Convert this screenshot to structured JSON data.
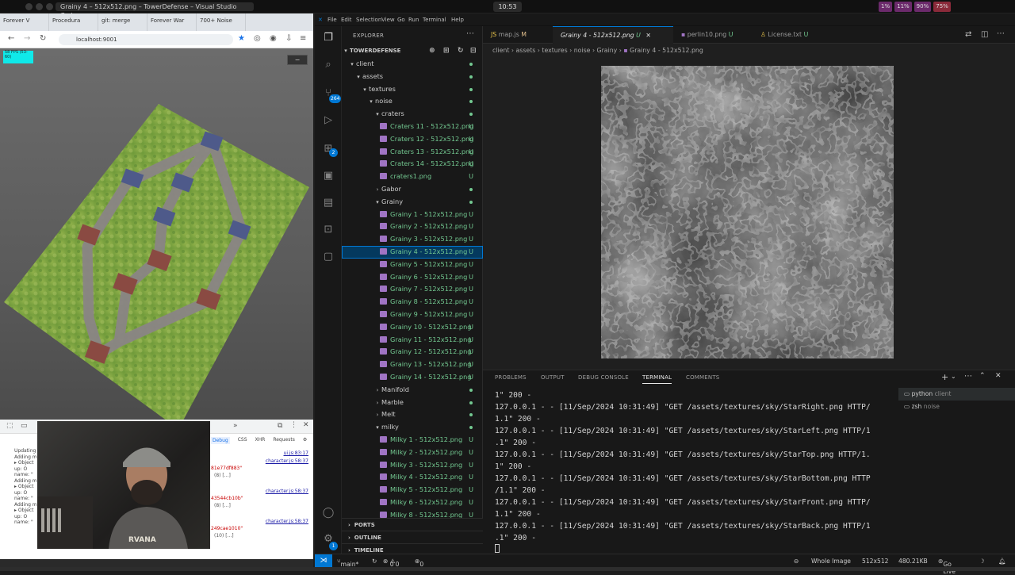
{
  "os": {
    "window_title": "Grainy 4 – 512x512.png – TowerDefense – Visual Studio Code",
    "clock": "10:53",
    "tray": [
      "1%",
      "11%",
      "90%",
      "75%"
    ]
  },
  "browser": {
    "tabs": [
      "Forever V",
      "Procedura",
      "git: merge",
      "Forever War",
      "700+ Noise"
    ],
    "url": "localhost:9001",
    "fps": "58 FPS (53-60)",
    "devtools": {
      "tabs": [
        "Debug",
        "CSS",
        "XHR",
        "Requests"
      ],
      "console_lines": [
        "Updating",
        "Adding m",
        "▸ Object",
        "  up: O",
        "  name: \"",
        "Adding m",
        "▸ Object",
        "  up: O",
        "  name: \"",
        "Adding m",
        "▸ Object",
        "  up: O",
        "  name: \""
      ],
      "sources": [
        "ui.js:83:17",
        "character.js:58:37",
        "character.js:58:37",
        "character.js:58:37"
      ],
      "values": [
        "81e77df883\"",
        "43544cb10b\"",
        "249cae1010\""
      ],
      "subs": [
        "(8) [...]",
        "(8) [...]",
        "(10) [...]"
      ]
    }
  },
  "vscode": {
    "menu": [
      "File",
      "Edit",
      "Selection",
      "View",
      "Go",
      "Run",
      "Terminal",
      "Help"
    ],
    "activity_badges": {
      "source_control": "264",
      "extensions": "2",
      "accounts": "1"
    },
    "explorer": {
      "title": "EXPLORER",
      "root": "TOWERDEFENSE",
      "rows": [
        {
          "label": "client",
          "depth": 1,
          "kind": "folder",
          "open": true,
          "git": "dot"
        },
        {
          "label": "assets",
          "depth": 2,
          "kind": "folder",
          "open": true,
          "git": "dot"
        },
        {
          "label": "textures",
          "depth": 3,
          "kind": "folder",
          "open": true,
          "git": "dot"
        },
        {
          "label": "noise",
          "depth": 4,
          "kind": "folder",
          "open": true,
          "git": "dot"
        },
        {
          "label": "craters",
          "depth": 5,
          "kind": "folder",
          "open": true,
          "git": "dot"
        },
        {
          "label": "Craters 11 - 512x512.png",
          "depth": 6,
          "kind": "file",
          "git": "U"
        },
        {
          "label": "Craters 12 - 512x512.png",
          "depth": 6,
          "kind": "file",
          "git": "U"
        },
        {
          "label": "Craters 13 - 512x512.png",
          "depth": 6,
          "kind": "file",
          "git": "U"
        },
        {
          "label": "Craters 14 - 512x512.png",
          "depth": 6,
          "kind": "file",
          "git": "U"
        },
        {
          "label": "craters1.png",
          "depth": 6,
          "kind": "file",
          "git": "U"
        },
        {
          "label": "Gabor",
          "depth": 5,
          "kind": "folder",
          "open": false,
          "git": "dot"
        },
        {
          "label": "Grainy",
          "depth": 5,
          "kind": "folder",
          "open": true,
          "git": "dot"
        },
        {
          "label": "Grainy 1 - 512x512.png",
          "depth": 6,
          "kind": "file",
          "git": "U"
        },
        {
          "label": "Grainy 2 - 512x512.png",
          "depth": 6,
          "kind": "file",
          "git": "U"
        },
        {
          "label": "Grainy 3 - 512x512.png",
          "depth": 6,
          "kind": "file",
          "git": "U"
        },
        {
          "label": "Grainy 4 - 512x512.png",
          "depth": 6,
          "kind": "file",
          "git": "U",
          "selected": true
        },
        {
          "label": "Grainy 5 - 512x512.png",
          "depth": 6,
          "kind": "file",
          "git": "U"
        },
        {
          "label": "Grainy 6 - 512x512.png",
          "depth": 6,
          "kind": "file",
          "git": "U"
        },
        {
          "label": "Grainy 7 - 512x512.png",
          "depth": 6,
          "kind": "file",
          "git": "U"
        },
        {
          "label": "Grainy 8 - 512x512.png",
          "depth": 6,
          "kind": "file",
          "git": "U"
        },
        {
          "label": "Grainy 9 - 512x512.png",
          "depth": 6,
          "kind": "file",
          "git": "U"
        },
        {
          "label": "Grainy 10 - 512x512.png",
          "depth": 6,
          "kind": "file",
          "git": "U"
        },
        {
          "label": "Grainy 11 - 512x512.png",
          "depth": 6,
          "kind": "file",
          "git": "U"
        },
        {
          "label": "Grainy 12 - 512x512.png",
          "depth": 6,
          "kind": "file",
          "git": "U"
        },
        {
          "label": "Grainy 13 - 512x512.png",
          "depth": 6,
          "kind": "file",
          "git": "U"
        },
        {
          "label": "Grainy 14 - 512x512.png",
          "depth": 6,
          "kind": "file",
          "git": "U"
        },
        {
          "label": "Manifold",
          "depth": 5,
          "kind": "folder",
          "open": false,
          "git": "dot"
        },
        {
          "label": "Marble",
          "depth": 5,
          "kind": "folder",
          "open": false,
          "git": "dot"
        },
        {
          "label": "Melt",
          "depth": 5,
          "kind": "folder",
          "open": false,
          "git": "dot"
        },
        {
          "label": "milky",
          "depth": 5,
          "kind": "folder",
          "open": true,
          "git": "dot"
        },
        {
          "label": "Milky 1 - 512x512.png",
          "depth": 6,
          "kind": "file",
          "git": "U"
        },
        {
          "label": "Milky 2 - 512x512.png",
          "depth": 6,
          "kind": "file",
          "git": "U"
        },
        {
          "label": "Milky 3 - 512x512.png",
          "depth": 6,
          "kind": "file",
          "git": "U"
        },
        {
          "label": "Milky 4 - 512x512.png",
          "depth": 6,
          "kind": "file",
          "git": "U"
        },
        {
          "label": "Milky 5 - 512x512.png",
          "depth": 6,
          "kind": "file",
          "git": "U"
        },
        {
          "label": "Milky 6 - 512x512.png",
          "depth": 6,
          "kind": "file",
          "git": "U"
        },
        {
          "label": "Milky 8 - 512x512.png",
          "depth": 6,
          "kind": "file",
          "git": "U"
        }
      ],
      "sections": [
        "PORTS",
        "OUTLINE",
        "TIMELINE"
      ]
    },
    "editor_tabs": [
      {
        "label": "map.js",
        "status": "M"
      },
      {
        "label": "Grainy 4 - 512x512.png",
        "status": "U",
        "active": true
      },
      {
        "label": "perlin10.png",
        "status": "U"
      },
      {
        "label": "License.txt",
        "status": "U"
      }
    ],
    "breadcrumbs": [
      "client",
      "assets",
      "textures",
      "noise",
      "Grainy",
      "Grainy 4 - 512x512.png"
    ],
    "panel_tabs": [
      "PROBLEMS",
      "OUTPUT",
      "DEBUG CONSOLE",
      "TERMINAL",
      "COMMENTS"
    ],
    "terminal_lines": [
      "1\" 200 -",
      "127.0.0.1 - - [11/Sep/2024 10:31:49] \"GET /assets/textures/sky/StarRight.png HTTP/",
      "1.1\" 200 -",
      "127.0.0.1 - - [11/Sep/2024 10:31:49] \"GET /assets/textures/sky/StarLeft.png HTTP/1",
      ".1\" 200 -",
      "127.0.0.1 - - [11/Sep/2024 10:31:49] \"GET /assets/textures/sky/StarTop.png HTTP/1.",
      "1\" 200 -",
      "127.0.0.1 - - [11/Sep/2024 10:31:49] \"GET /assets/textures/sky/StarBottom.png HTTP",
      "/1.1\" 200 -",
      "127.0.0.1 - - [11/Sep/2024 10:31:49] \"GET /assets/textures/sky/StarFront.png HTTP/",
      "1.1\" 200 -",
      "127.0.0.1 - - [11/Sep/2024 10:31:49] \"GET /assets/textures/sky/StarBack.png HTTP/1",
      ".1\" 200 -"
    ],
    "terminals": [
      {
        "name": "python",
        "dir": "client",
        "active": true
      },
      {
        "name": "zsh",
        "dir": "noise",
        "active": false
      }
    ],
    "status": {
      "branch": "main*",
      "errors": "0",
      "warnings": "0",
      "ports": "0",
      "zoom": "Whole Image",
      "dims": "512x512",
      "size": "480.21KB",
      "golive": "Go Live"
    }
  }
}
